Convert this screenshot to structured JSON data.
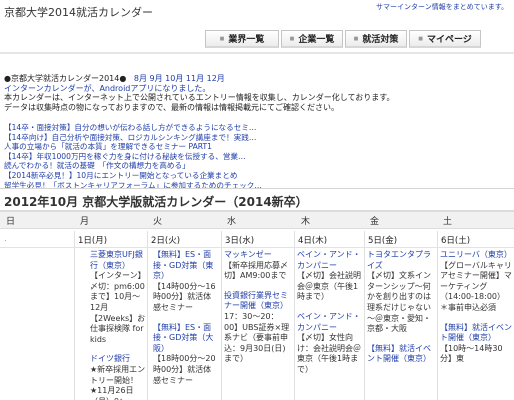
{
  "header": {
    "site_title": "京都大学2014就活カレンダー",
    "tagline": "サマーインターン情報をまとめています。"
  },
  "nav": {
    "tabs": [
      "業界一覧",
      "企業一覧",
      "就活対策",
      "マイページ"
    ]
  },
  "info": {
    "calendar_name": "●京都大学就活カレンダー2014●",
    "months": [
      "8月",
      "9月",
      "10月",
      "11月",
      "12月"
    ],
    "android_notice": "インターンカレンダーが、Androidアプリになりました。",
    "desc_1": "本カレンダーは、インターネット上で公開されているエントリー情報を収集し、カレンダー化しております。",
    "desc_2": "データは収集時点の物になっておりますので、最新の情報は情報掲載元にてご確認ください。"
  },
  "news_links": [
    "【14卒・面接対策】自分の想いが伝わる話し方ができるようになるセミ…",
    "【14卒向け】自己分析や面接対策、ロジカルシンキング講座まで！実践…",
    "人事の立場から「就活の本質」を理解できるセミナー PART1",
    "【14卒】年収1000万円を稼ぐ力を身に付ける秘訣を伝授する、営業…",
    "読んでわかる！就活の基礎　「作文の構想力を高める」",
    "【2014新卒必見！】10月にエントリー開始となっている企業まとめ",
    "留学生必見！「ボストンキャリアフォーラム」に参加するためのチェック…"
  ],
  "calendar": {
    "title": "2012年10月 京都大学版就活カレンダー（2014新卒）",
    "weekdays": [
      "日",
      "月",
      "火",
      "水",
      "木",
      "金",
      "土"
    ],
    "days": [
      {
        "label": ".",
        "events": []
      },
      {
        "label": "1日(月)",
        "events": [
          {
            "company": "三菱東京UFJ銀行（東京）",
            "body": "【インターン】〆切：pm6:00まで】10月～12月【2Weeks】お仕事探検隊 for kids"
          },
          {
            "company": "ドイツ銀行",
            "body": "★新卒採用エントリー開始！★11月26日（月）9："
          }
        ]
      },
      {
        "label": "2日(火)",
        "events": [
          {
            "company": "【無料】ES・面接・GD対策（東京）",
            "body": "【14時00分～16時00分】就活体感セミナー"
          },
          {
            "company": "【無料】ES・面接・GD対策（大阪）",
            "body": "【18時00分～20時00分】就活体感セミナー"
          }
        ]
      },
      {
        "label": "3日(水)",
        "events": [
          {
            "company": "マッキンゼー",
            "body": "【新卒採用応募〆切】AM9:00まで"
          },
          {
            "company": "投資銀行業界セミナー開催（東京）",
            "body": "17：30～20：00】UBS証券×理系ナビ（要事前申込：9月30日(日)まで）"
          }
        ]
      },
      {
        "label": "4日(木)",
        "events": [
          {
            "company": "ベイン・アンド・カンパニー",
            "body": "【〆切】会社説明会＠東京（午後1時まで）"
          },
          {
            "company": "ベイン・アンド・カンパニー",
            "body": "【〆切】女性向け：会社説明会＠東京（午後1時まで）"
          }
        ]
      },
      {
        "label": "5日(金)",
        "events": [
          {
            "company": "トヨタエンタプライズ",
            "body": "【〆切】文系インターンシップ～何かを創り出すのは理系だけじゃない～＠東京・愛知・京都・大阪"
          },
          {
            "company": "【無料】就活イベント開催（東京）",
            "body": ""
          }
        ]
      },
      {
        "label": "6日(土)",
        "events": [
          {
            "company": "ユニリーバ（東京）",
            "body": "【グローバルキャリアセミナー開催】マーケティング（14:00-18:00）＊事前申込必須"
          },
          {
            "company": "【無料】就活イベント開催（東京）",
            "body": "【10時～14時30分】東"
          }
        ]
      }
    ]
  }
}
